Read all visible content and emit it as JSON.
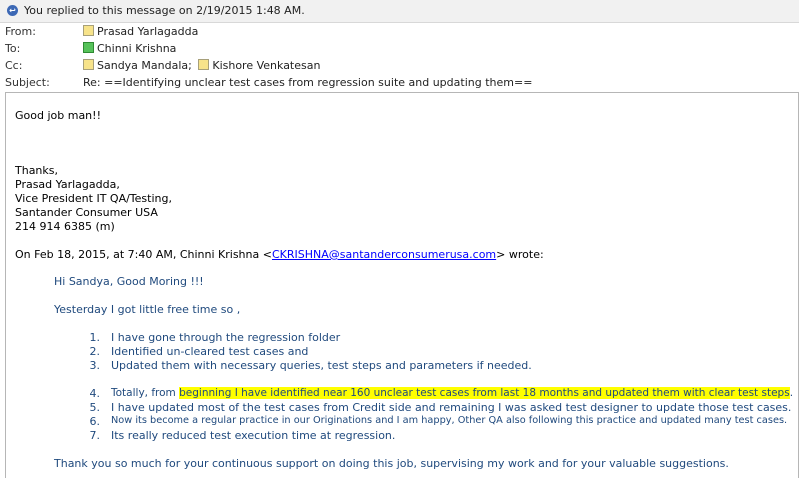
{
  "info_bar": {
    "icon": "reply-info-icon",
    "text": "You replied to this message on 2/19/2015 1:48 AM."
  },
  "header": {
    "from_label": "From:",
    "from": "Prasad Yarlagadda",
    "to_label": "To:",
    "to": "Chinni Krishna",
    "cc_label": "Cc:",
    "cc": [
      "Sandya Mandala;",
      "Kishore Venkatesan"
    ],
    "subject_label": "Subject:",
    "subject": "Re: ==Identifying unclear test cases from regression suite and updating them=="
  },
  "reply": {
    "message": "Good job man!!",
    "signature": [
      "Thanks,",
      "Prasad Yarlagadda,",
      "Vice President IT QA/Testing,",
      "Santander Consumer USA",
      "214 914 6385 (m)"
    ]
  },
  "quoted": {
    "intro_before": "On Feb 18, 2015, at 7:40 AM, Chinni Krishna <",
    "email": "CKRISHNA@santanderconsumerusa.com",
    "intro_after": "> wrote:",
    "greeting": "Hi Sandya, Good Moring !!!",
    "line1": "Yesterday I got little free time so ,",
    "list_a": [
      {
        "n": "1.",
        "text": "I have gone through the regression folder"
      },
      {
        "n": "2.",
        "text": "Identified un-cleared test cases and"
      },
      {
        "n": "3.",
        "text": "Updated them with necessary queries, test steps and parameters if needed."
      }
    ],
    "item4_n": "4.",
    "item4_before": "Totally, from ",
    "item4_highlight": "beginning I have identified near 160 unclear test cases from last 18 months and updated them with clear test steps",
    "item4_after": ".",
    "list_b": [
      {
        "n": "5.",
        "text": "I have updated most of the test cases from Credit side and remaining I was asked test designer  to update those test cases."
      },
      {
        "n": "6.",
        "text": "Now its become a regular practice in our Originations and I am happy, Other QA also following this practice and updated many test cases."
      },
      {
        "n": "7.",
        "text": "Its really reduced test execution time at regression."
      }
    ],
    "closing": "Thank you so much for your continuous support on doing this job, supervising my work and for your valuable suggestions."
  }
}
